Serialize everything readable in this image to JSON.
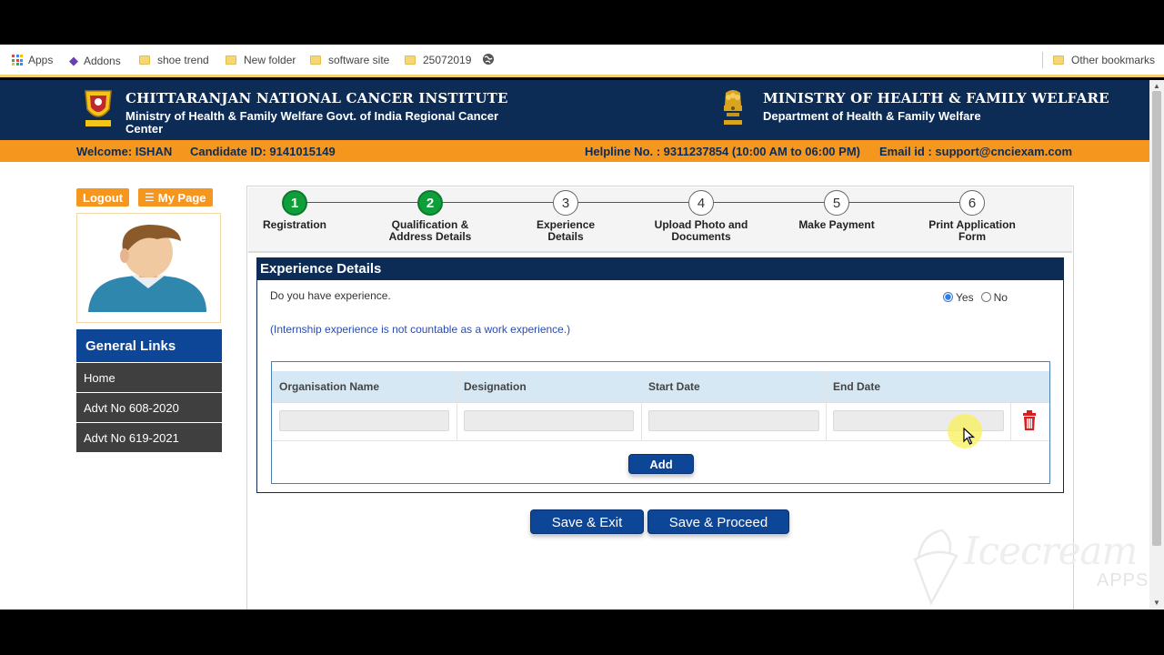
{
  "bookmarks": {
    "apps": "Apps",
    "addons": "Addons",
    "items": [
      "shoe trend",
      "New folder",
      "software site",
      "25072019"
    ],
    "other": "Other bookmarks"
  },
  "header": {
    "left_title": "CHITTARANJAN NATIONAL CANCER INSTITUTE",
    "left_sub": "Ministry of Health & Family Welfare Govt. of India Regional Cancer Center",
    "right_title": "MINISTRY OF HEALTH & FAMILY WELFARE",
    "right_sub": "Department of Health & Family Welfare"
  },
  "infobar": {
    "welcome": "Welcome: ISHAN",
    "candidate": "Candidate ID: 9141015149",
    "helpline": "Helpline No. : 9311237854 (10:00 AM to 06:00 PM)",
    "email": "Email id : support@cnciexam.com"
  },
  "actions": {
    "logout": "Logout",
    "mypage": "My Page"
  },
  "general_links": {
    "title": "General Links",
    "items": [
      "Home",
      "Advt No 608-2020",
      "Advt No 619-2021"
    ]
  },
  "steps": [
    {
      "num": "1",
      "label": "Registration",
      "done": true
    },
    {
      "num": "2",
      "label": "Qualification & Address Details",
      "done": true
    },
    {
      "num": "3",
      "label": "Experience Details",
      "done": false
    },
    {
      "num": "4",
      "label": "Upload Photo and Documents",
      "done": false
    },
    {
      "num": "5",
      "label": "Make Payment",
      "done": false
    },
    {
      "num": "6",
      "label": "Print Application Form",
      "done": false
    }
  ],
  "experience": {
    "title": "Experience Details",
    "question": "Do you have experience.",
    "yes": "Yes",
    "no": "No",
    "selected": "Yes",
    "note": "(Internship experience is not countable as a work experience.)",
    "columns": [
      "Organisation Name",
      "Designation",
      "Start Date",
      "End Date"
    ],
    "row": [
      "",
      "",
      "",
      ""
    ],
    "add": "Add"
  },
  "buttons": {
    "save_exit": "Save & Exit",
    "save_proceed": "Save & Proceed"
  },
  "watermark": {
    "text": "Icecream",
    "sub": "APPS"
  },
  "colors": {
    "navy": "#0c2c55",
    "orange": "#f5961f",
    "green": "#0e9f3b",
    "blue": "#0d4597"
  }
}
